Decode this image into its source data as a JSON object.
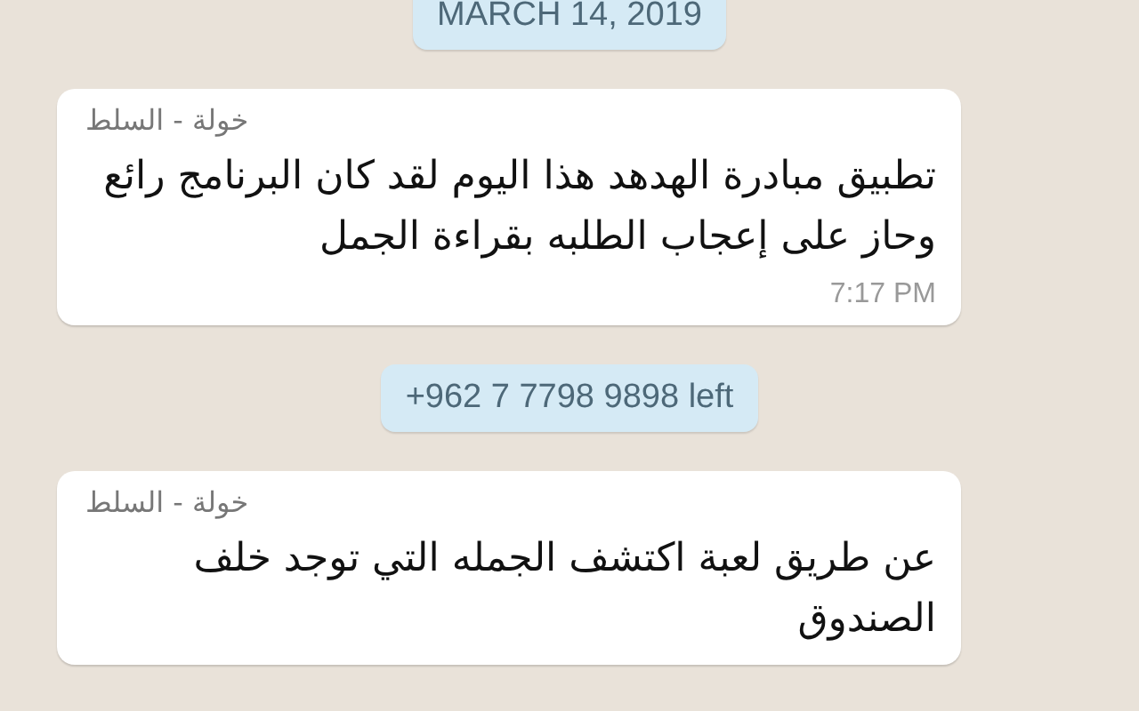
{
  "date_chip": "MARCH 14, 2019",
  "messages": [
    {
      "kind": "message",
      "sender": "خولة - السلط",
      "text": "تطبيق مبادرة الهدهد هذا اليوم لقد كان البرنامج رائع وحاز على إعجاب الطلبه بقراءة الجمل",
      "time": "7:17 PM"
    },
    {
      "kind": "notice",
      "text": "+962 7 7798 9898 left"
    },
    {
      "kind": "message",
      "sender": "خولة - السلط",
      "text": "عن طريق لعبة اكتشف الجمله التي توجد خلف الصندوق"
    }
  ]
}
